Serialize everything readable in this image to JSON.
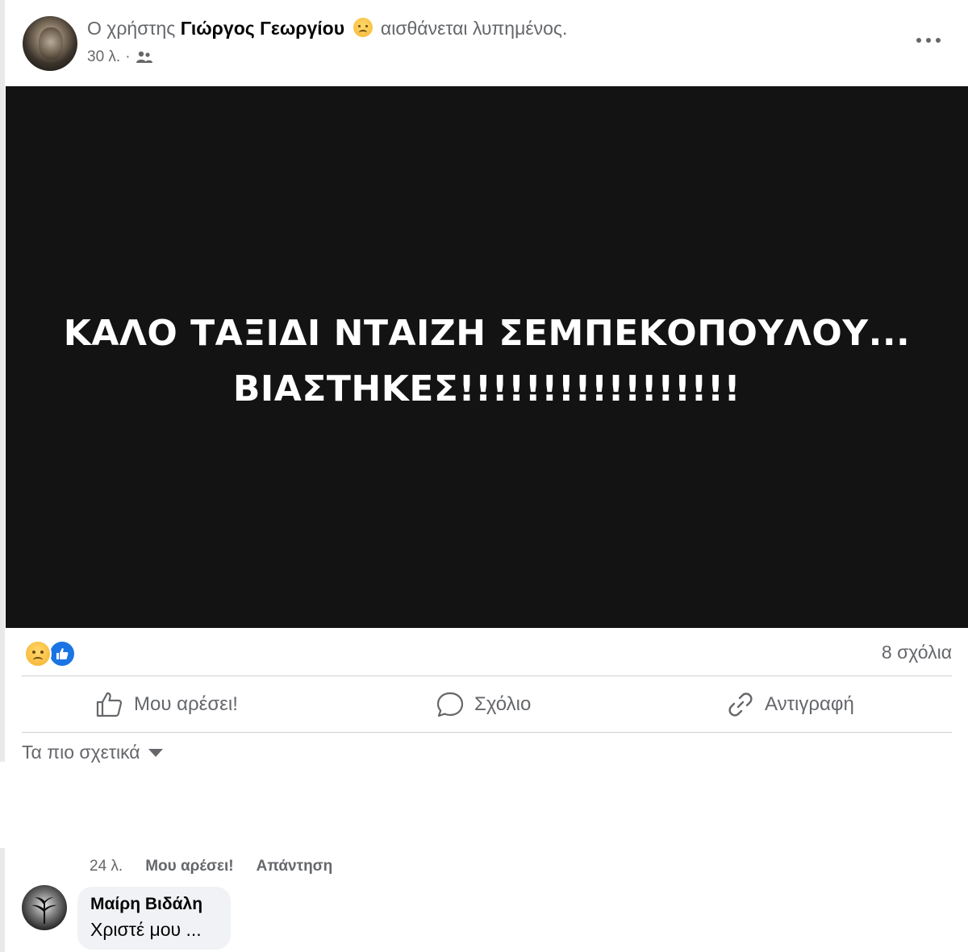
{
  "post": {
    "header_prefix": "Ο χρήστης",
    "author": "Γιώργος Γεωργίου",
    "feeling_icon": "sad-face-emoji",
    "feeling_text": "αισθάνεται λυπημένος.",
    "time": "30 λ.",
    "separator": "·",
    "audience_icon": "friends-icon"
  },
  "image": {
    "line1": "ΚΑΛΟ ΤΑΞΙΔΙ ΝΤΑΙΖΗ ΣΕΜΠΕΚΟΠΟΥΛΟΥ...",
    "line2": "ΒΙΑΣΤΗΚΕΣ!!!!!!!!!!!!!!!!!"
  },
  "stats": {
    "reaction_icons": [
      "sad-reaction-icon",
      "like-reaction-icon"
    ],
    "comments_count": "8 σχόλια"
  },
  "actions": {
    "like": "Μου αρέσει!",
    "comment": "Σχόλιο",
    "copy": "Αντιγραφή"
  },
  "sort": {
    "label": "Τα πιο σχετικά"
  },
  "comments": [
    {
      "time": "24 λ.",
      "like": "Μου αρέσει!",
      "reply": "Απάντηση"
    },
    {
      "name": "Μαίρη Βιδάλη",
      "text": "Χριστέ μου ..."
    }
  ],
  "colors": {
    "secondary_text": "#65676b",
    "primary_text": "#050505",
    "image_background": "#131313",
    "like_blue": "#1b74e4",
    "bubble": "#f0f2f5"
  }
}
